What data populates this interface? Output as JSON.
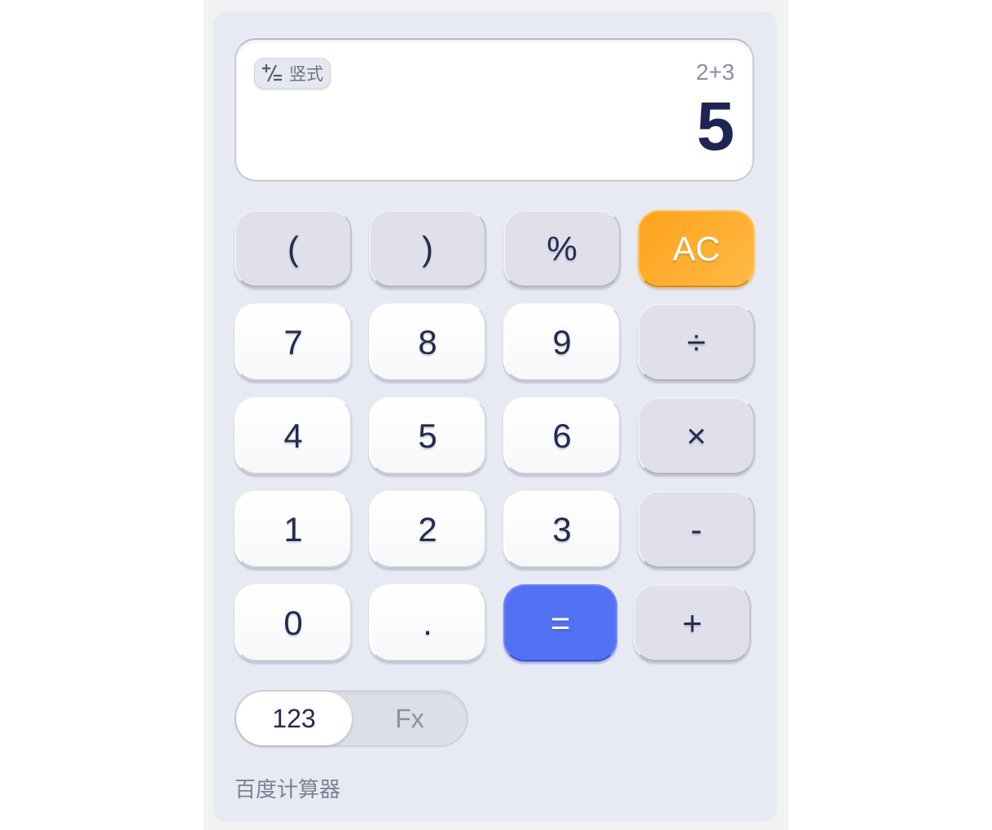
{
  "display": {
    "vertical_toggle_label": "竖式",
    "vertical_toggle_icon": "plus-minus-equals-icon",
    "expression": "2+3",
    "result": "5"
  },
  "keys": {
    "lparen": "(",
    "rparen": ")",
    "percent": "%",
    "ac": "AC",
    "seven": "7",
    "eight": "8",
    "nine": "9",
    "divide": "÷",
    "four": "4",
    "five": "5",
    "six": "6",
    "multiply": "×",
    "one": "1",
    "two": "2",
    "three": "3",
    "minus": "-",
    "zero": "0",
    "dot": ".",
    "equals": "=",
    "plus": "+"
  },
  "mode": {
    "basic_label": "123",
    "function_label": "Fx",
    "selected": "123"
  },
  "brand": "百度计算器",
  "colors": {
    "accent_orange": "#ffa21c",
    "accent_blue": "#5371f3",
    "text_dark": "#252a52",
    "panel_bg": "#e7eaf3"
  }
}
